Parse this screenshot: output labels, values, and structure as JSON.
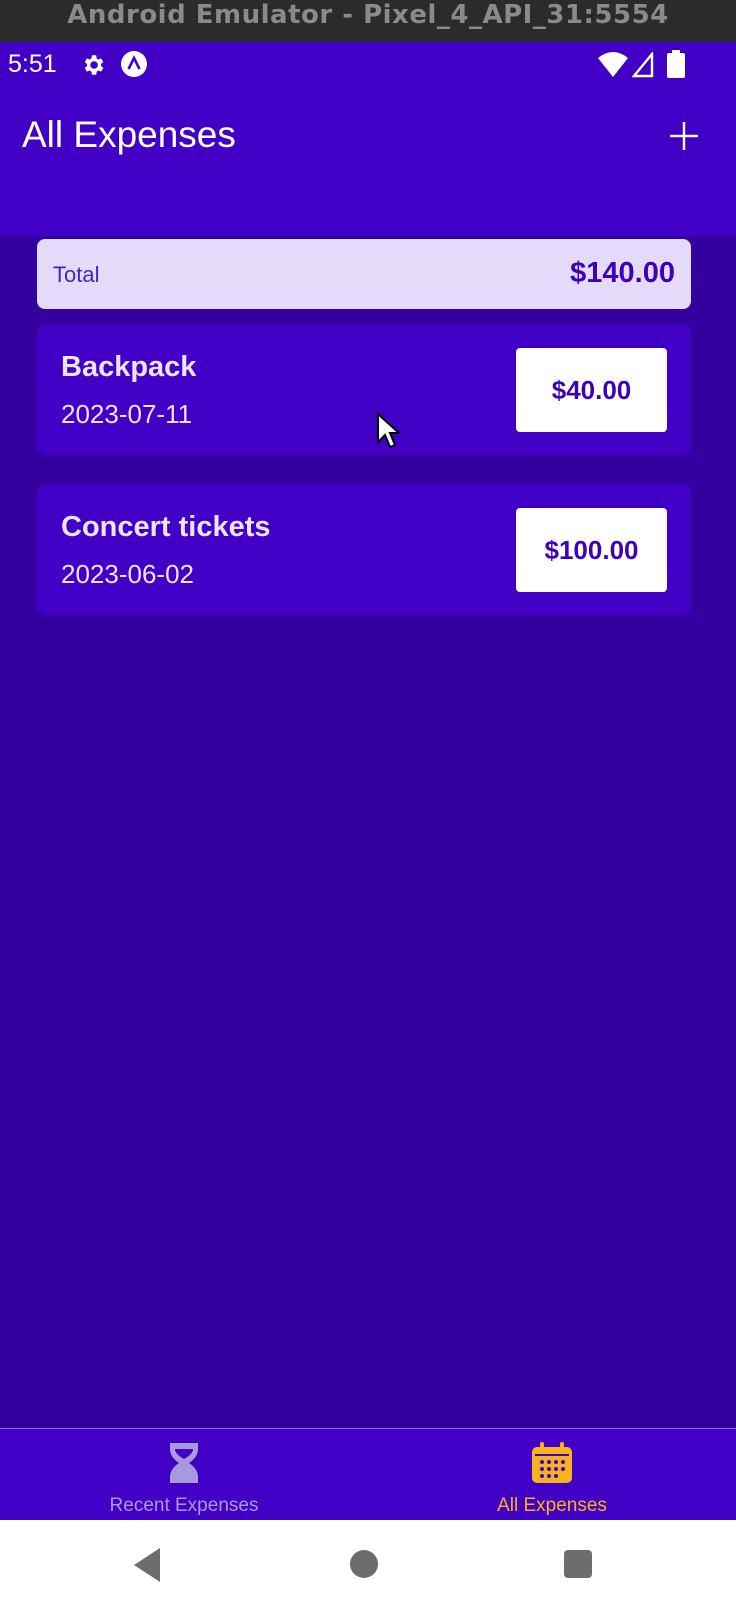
{
  "window": {
    "title": "Android Emulator - Pixel_4_API_31:5554"
  },
  "status_bar": {
    "time": "5:51",
    "icons": [
      "gear-icon",
      "a-notification-icon",
      "wifi-icon",
      "signal-icon",
      "battery-icon"
    ]
  },
  "app_bar": {
    "title": "All Expenses",
    "add_icon": "plus-icon"
  },
  "summary": {
    "label": "Total",
    "value": "$140.00"
  },
  "expenses": [
    {
      "title": "Backpack",
      "date": "2023-07-11",
      "amount": "$40.00"
    },
    {
      "title": "Concert tickets",
      "date": "2023-06-02",
      "amount": "$100.00"
    }
  ],
  "bottom_tabs": [
    {
      "label": "Recent Expenses",
      "icon": "hourglass-icon",
      "active": false
    },
    {
      "label": "All Expenses",
      "icon": "calendar-icon",
      "active": true
    }
  ],
  "colors": {
    "header": "#4200c7",
    "background": "#3400a0",
    "summary_bg": "#e4dbfa",
    "accent": "#f7b31b",
    "inactive_tab": "#a99ae0"
  }
}
